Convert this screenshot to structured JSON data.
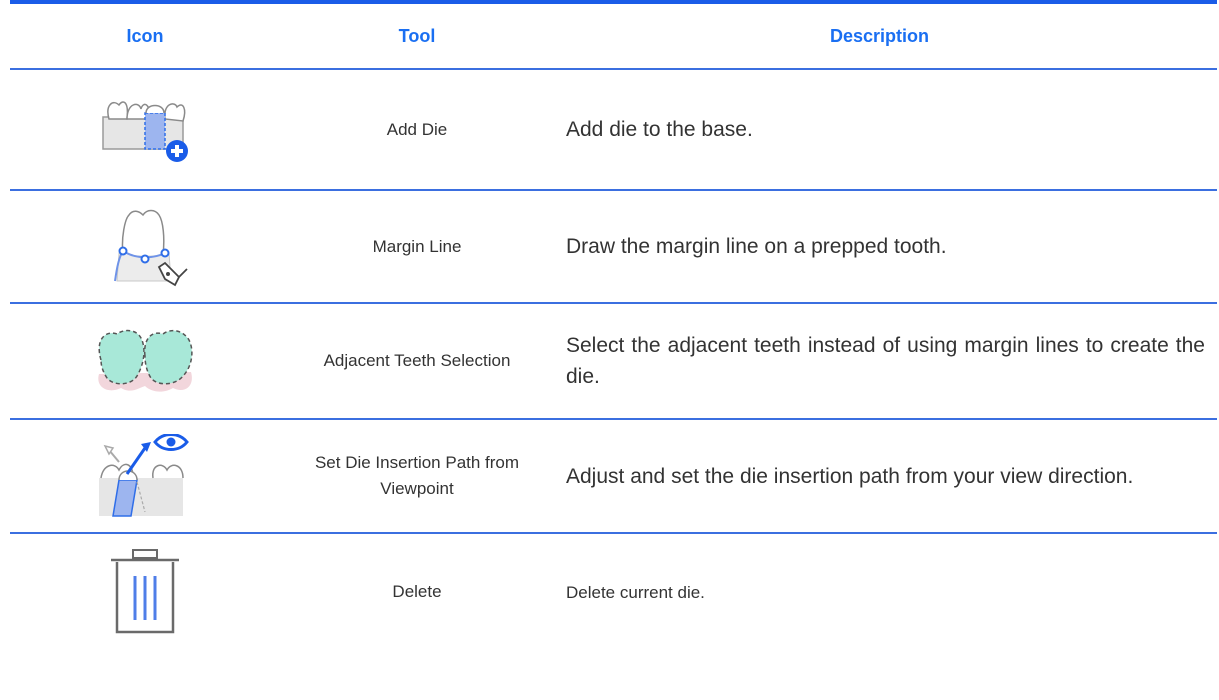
{
  "header": {
    "icon": "Icon",
    "tool": "Tool",
    "description": "Description"
  },
  "rows": [
    {
      "icon": "add-die-icon",
      "tool": "Add Die",
      "description": "Add die to the base."
    },
    {
      "icon": "margin-line-icon",
      "tool": "Margin Line",
      "description": "Draw the margin line on a prepped tooth."
    },
    {
      "icon": "adjacent-teeth-selection-icon",
      "tool": "Adjacent Teeth Selection",
      "description": "Select the adjacent teeth instead of using margin lines to create the die."
    },
    {
      "icon": "set-die-insertion-path-icon",
      "tool": "Set Die Insertion Path from Viewpoint",
      "description": "Adjust and set the die insertion path from your view direction."
    },
    {
      "icon": "trash-icon",
      "tool": "Delete",
      "description": "Delete current die."
    }
  ],
  "colors": {
    "accent": "#1a6ff2",
    "rule": "#3b6fe0",
    "text": "#333333",
    "teeth_fill": "#a8e8d8",
    "gum_fill": "#f2d6dc"
  }
}
